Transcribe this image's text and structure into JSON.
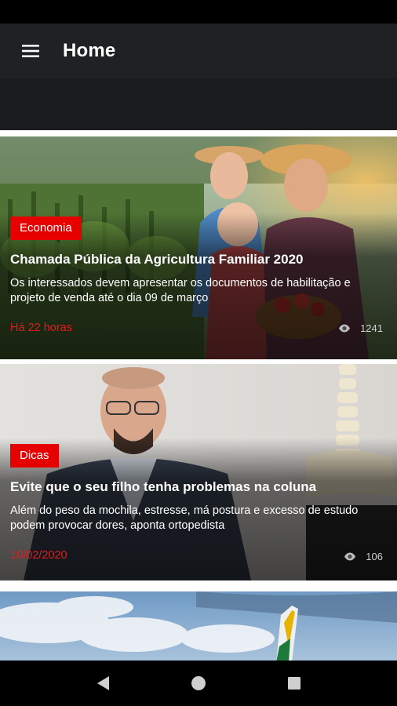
{
  "app_bar": {
    "title": "Home"
  },
  "articles": [
    {
      "category": "Economia",
      "title": "Chamada Pública da Agricultura Familiar 2020",
      "description": "Os interessados devem apresentar os documentos de habilitação e projeto de venda até o dia 09 de março",
      "time": "Há 22 horas",
      "views": "1241"
    },
    {
      "category": "Dicas",
      "title": "Evite que o seu filho tenha problemas na coluna",
      "description": "Além do peso da mochila, estresse, má postura e excesso de estudo podem provocar dores, aponta ortopedista",
      "time": "10/02/2020",
      "views": "106"
    }
  ],
  "colors": {
    "accent_red": "#e60000",
    "app_bar_bg": "#1f2224",
    "time_red": "#e41b1b"
  },
  "icons": {
    "menu": "menu-icon",
    "views": "eye-icon",
    "nav_back": "back-triangle-icon",
    "nav_home": "home-circle-icon",
    "nav_recents": "recents-square-icon"
  }
}
